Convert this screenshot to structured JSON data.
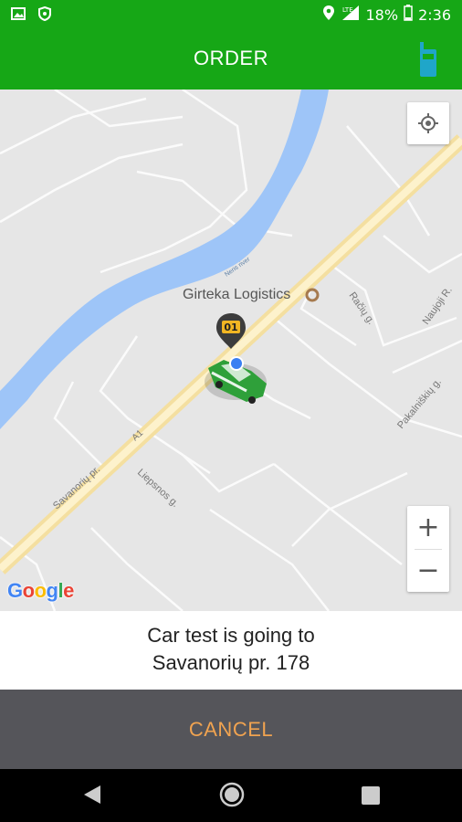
{
  "status_bar": {
    "battery": "18%",
    "time": "2:36",
    "network": "LTE"
  },
  "app_bar": {
    "title": "ORDER"
  },
  "map": {
    "poi_label": "Girteka Logistics",
    "streets": [
      "Neris river",
      "Savanorių pr.",
      "A1",
      "Liepsnos g.",
      "Račių g.",
      "Naujoji R.",
      "Pakalniškių g."
    ],
    "driver_badge": "01",
    "zoom_in": "+",
    "zoom_out": "−",
    "google_logo": [
      "G",
      "o",
      "o",
      "g",
      "l",
      "e"
    ]
  },
  "info": {
    "line1": "Car test is going to",
    "line2": "Savanorių pr. 178"
  },
  "action": {
    "cancel_label": "CANCEL"
  },
  "colors": {
    "brand_green": "#16a716",
    "cancel_bg": "#55555a",
    "cancel_text": "#f0a350",
    "river": "#9ec5f8"
  }
}
